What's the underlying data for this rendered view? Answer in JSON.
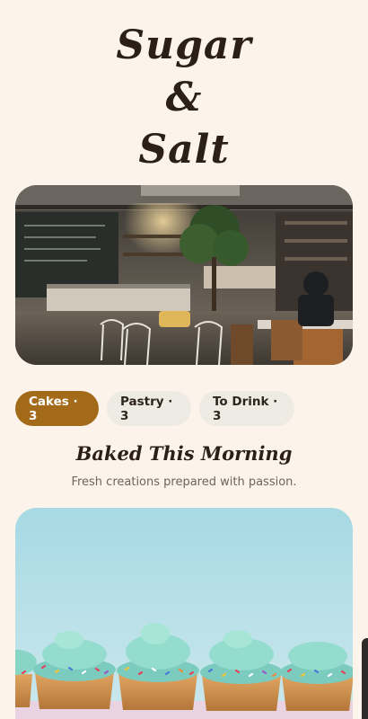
{
  "brand": {
    "line1": "Sugar",
    "line2": "&",
    "line3": "Salt"
  },
  "tabs": [
    {
      "label": "Cakes · 3",
      "active": true
    },
    {
      "label": "Pastry · 3",
      "active": false
    },
    {
      "label": "To Drink · 3",
      "active": false
    }
  ],
  "section": {
    "title": "Baked This Morning",
    "subtitle": "Fresh creations prepared with passion."
  },
  "colors": {
    "background": "#fcf3ea",
    "accent": "#a36a19",
    "tab_inactive": "#eeeae4",
    "text_dark": "#2b2016",
    "text_muted": "#6f6458"
  }
}
